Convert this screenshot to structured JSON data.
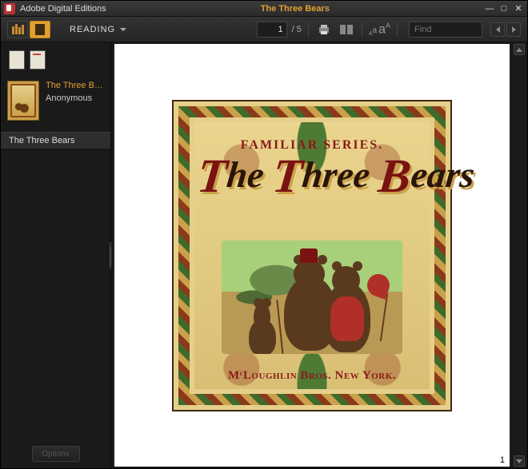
{
  "titlebar": {
    "app_name": "Adobe Digital Editions",
    "doc_title": "The Three Bears"
  },
  "toolbar": {
    "reading_label": "READING",
    "current_page": "1",
    "total_pages": "/ 5",
    "find_placeholder": "Find"
  },
  "sidebar": {
    "book_title": "The Three B…",
    "author": "Anonymous",
    "toc_entry": "The Three Bears",
    "options_label": "Options"
  },
  "page": {
    "number": "1",
    "cover": {
      "series_label": "FAMILIAR SERIES.",
      "title_html": "The Three Bears",
      "publisher": "MᶜLoughlin Bros. New York."
    }
  }
}
